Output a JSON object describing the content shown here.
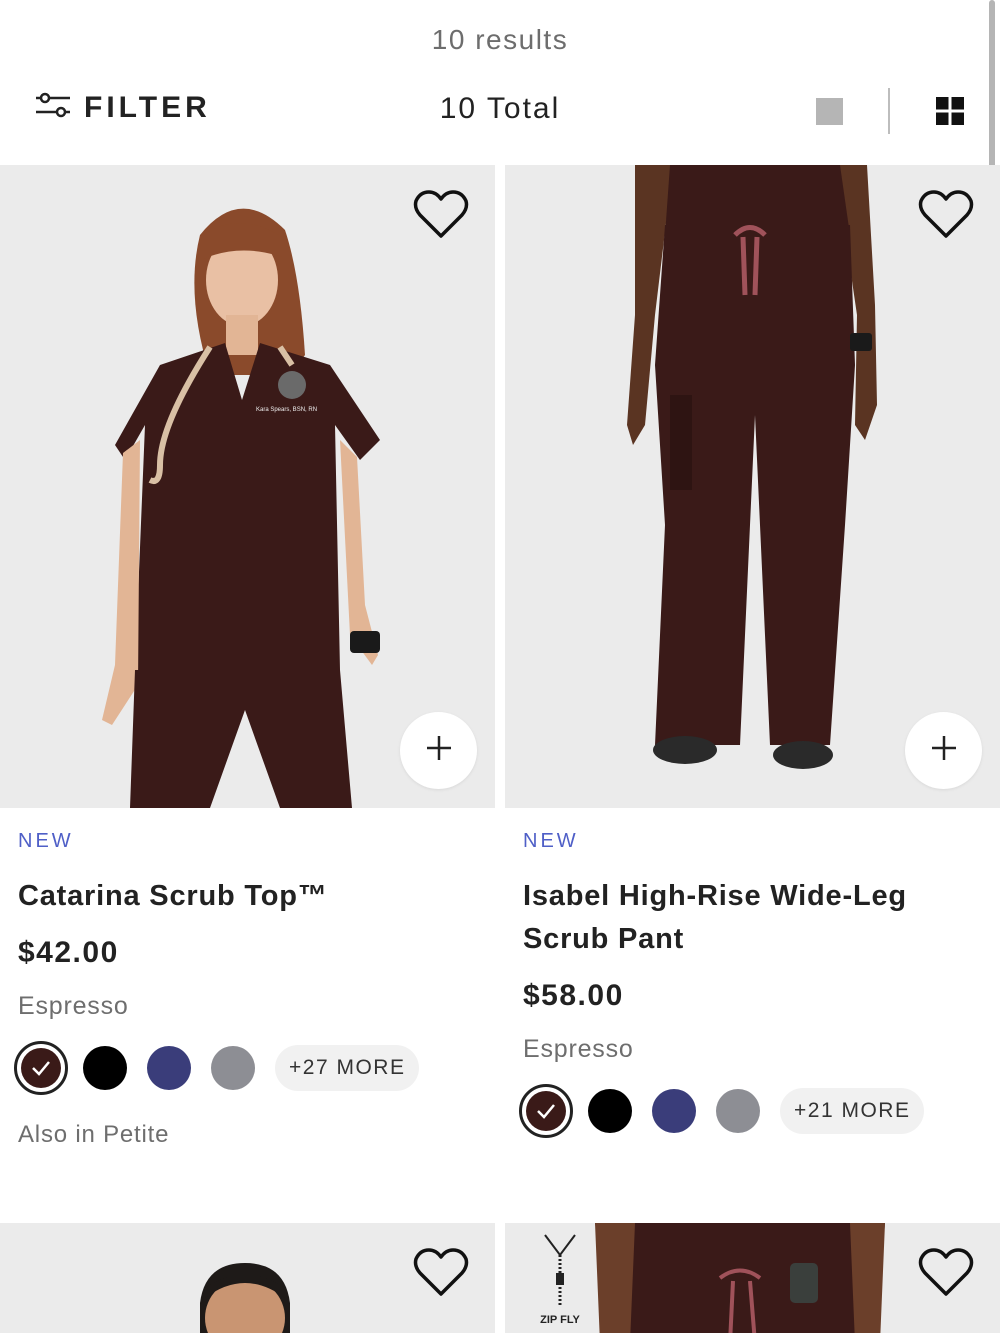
{
  "header": {
    "results": "10 results",
    "filter_label": "FILTER",
    "total": "10 Total"
  },
  "products": [
    {
      "badge": "NEW",
      "name": "Catarina Scrub Top™",
      "price": "$42.00",
      "color_name": "Espresso",
      "swatches": [
        "#3a1a18",
        "#000000",
        "#3a3d7a",
        "#8d8e94"
      ],
      "more": "+27 MORE",
      "also": "Also in Petite"
    },
    {
      "badge": "NEW",
      "name": "Isabel High-Rise Wide-Leg Scrub Pant",
      "price": "$58.00",
      "color_name": "Espresso",
      "swatches": [
        "#3a1a18",
        "#000000",
        "#3a3d7a",
        "#8d8e94"
      ],
      "more": "+21 MORE"
    }
  ],
  "second_row": {
    "zip_label": "ZIP FLY"
  },
  "icons": {
    "filter": "filter-sliders-icon",
    "single_view": "single-view-icon",
    "grid_view": "grid-view-icon",
    "wishlist": "heart-icon",
    "quick_add": "plus-icon",
    "selected": "check-icon"
  },
  "colors": {
    "accent": "#4f5fc7",
    "espresso": "#3a1a18",
    "text": "#222222",
    "muted": "#6e6e6e"
  }
}
